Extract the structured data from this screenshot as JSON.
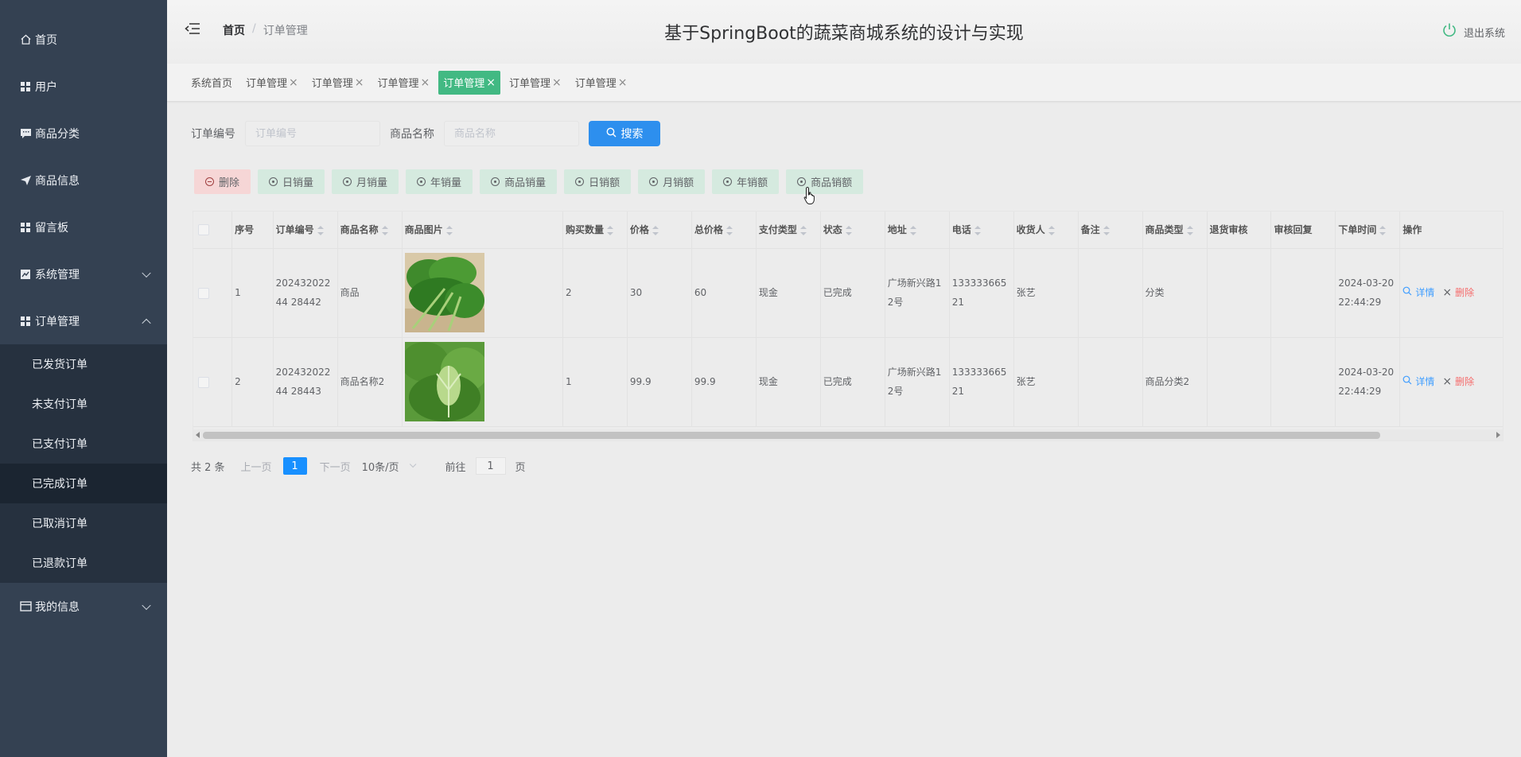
{
  "sidebar": {
    "items": [
      {
        "label": "首页",
        "icon": "home-icon"
      },
      {
        "label": "用户",
        "icon": "grid-icon"
      },
      {
        "label": "商品分类",
        "icon": "comment-icon"
      },
      {
        "label": "商品信息",
        "icon": "send-icon"
      },
      {
        "label": "留言板",
        "icon": "grid-icon"
      },
      {
        "label": "系统管理",
        "icon": "chart-icon"
      },
      {
        "label": "订单管理",
        "icon": "grid-icon"
      }
    ],
    "order_submenu": [
      "已发货订单",
      "未支付订单",
      "已支付订单",
      "已完成订单",
      "已取消订单",
      "已退款订单"
    ],
    "active_submenu": "已完成订单",
    "my_info": "我的信息"
  },
  "header": {
    "crumb_home": "首页",
    "crumb_sep": "/",
    "crumb_current": "订单管理",
    "title": "基于SpringBoot的蔬菜商城系统的设计与实现",
    "logout": "退出系统"
  },
  "tabs": [
    {
      "label": "系统首页",
      "closable": false
    },
    {
      "label": "订单管理",
      "closable": true
    },
    {
      "label": "订单管理",
      "closable": true
    },
    {
      "label": "订单管理",
      "closable": true
    },
    {
      "label": "订单管理",
      "closable": true,
      "active": true
    },
    {
      "label": "订单管理",
      "closable": true
    },
    {
      "label": "订单管理",
      "closable": true
    }
  ],
  "search": {
    "order_no_label": "订单编号",
    "order_no_placeholder": "订单编号",
    "product_name_label": "商品名称",
    "product_name_placeholder": "商品名称",
    "search_button": "搜索"
  },
  "actions": {
    "delete": "删除",
    "stats": [
      "日销量",
      "月销量",
      "年销量",
      "商品销量",
      "日销额",
      "月销额",
      "年销额",
      "商品销额"
    ]
  },
  "table": {
    "columns": [
      "序号",
      "订单编号",
      "商品名称",
      "商品图片",
      "购买数量",
      "价格",
      "总价格",
      "支付类型",
      "状态",
      "地址",
      "电话",
      "收货人",
      "备注",
      "商品类型",
      "退货审核",
      "审核回复",
      "下单时间",
      "操作"
    ],
    "rows": [
      {
        "index": "1",
        "order_no": "20243202244 28442",
        "product_name": "商品",
        "qty": "2",
        "price": "30",
        "total": "60",
        "pay_type": "现金",
        "status": "已完成",
        "address": "广场新兴路12号",
        "phone": "13333366521",
        "receiver": "张艺",
        "remark": "",
        "product_type": "分类",
        "return_audit": "",
        "audit_reply": "",
        "order_time": "2024-03-20 22:44:29"
      },
      {
        "index": "2",
        "order_no": "20243202244 28443",
        "product_name": "商品名称2",
        "qty": "1",
        "price": "99.9",
        "total": "99.9",
        "pay_type": "现金",
        "status": "已完成",
        "address": "广场新兴路12号",
        "phone": "13333366521",
        "receiver": "张艺",
        "remark": "",
        "product_type": "商品分类2",
        "return_audit": "",
        "audit_reply": "",
        "order_time": "2024-03-20 22:44:29"
      }
    ],
    "op_detail": "详情",
    "op_delete": "删除"
  },
  "pager": {
    "total": "共 2 条",
    "prev": "上一页",
    "current": "1",
    "next": "下一页",
    "page_size": "10条/页",
    "goto_label": "前往",
    "goto_value": "1",
    "page_unit": "页"
  },
  "colors": {
    "sidebar": "#344152",
    "accent_green": "#42b983",
    "primary_blue": "#2d8fee",
    "danger": "#f56c6c"
  }
}
